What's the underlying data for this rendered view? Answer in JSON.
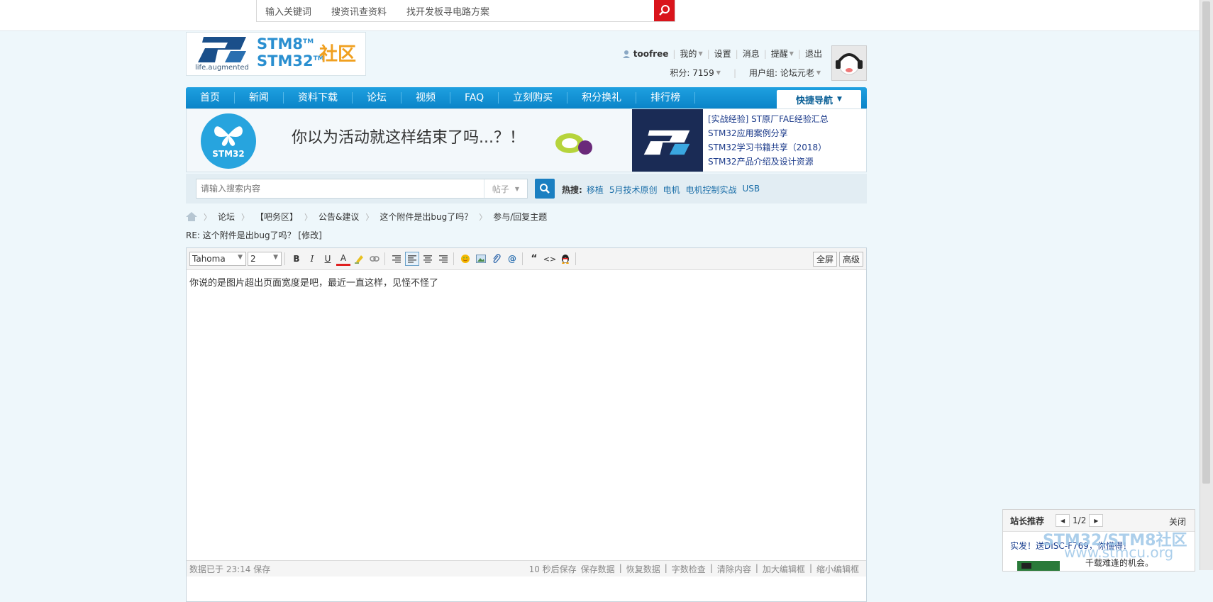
{
  "top_search": {
    "items": [
      "输入关键词",
      "搜资讯查资料",
      "找开发板寻电路方案"
    ]
  },
  "logo": {
    "tagline": "life.augmented",
    "line1": "STM8",
    "line2": "STM32",
    "tm": "TM",
    "community": "社区"
  },
  "user": {
    "name": "toofree",
    "links": [
      "我的",
      "设置",
      "消息",
      "提醒",
      "退出"
    ],
    "points": "积分: 7159",
    "group": "用户组: 论坛元老"
  },
  "nav": {
    "items": [
      "首页",
      "新闻",
      "资料下载",
      "论坛",
      "视频",
      "FAQ",
      "立刻购买",
      "积分换礼",
      "排行榜"
    ],
    "quick": "快捷导航"
  },
  "banner": {
    "ad_text": "你以为活动就这样结束了吗...？！",
    "ad_logo": "STM32",
    "links": [
      "[实战经验] ST原厂FAE经验汇总",
      "STM32应用案例分享",
      "STM32学习书籍共享（2018）",
      "STM32产品介绍及设计资源"
    ]
  },
  "search": {
    "placeholder": "请输入搜索内容",
    "type": "帖子",
    "hot_label": "热搜:",
    "hot": [
      "移植",
      "5月技术原创",
      "电机",
      "电机控制实战",
      "USB"
    ]
  },
  "breadcrumb": [
    "论坛",
    "【吧务区】",
    "公告&建议",
    "这个附件是出bug了吗？",
    "参与/回复主题"
  ],
  "subject": "RE: 这个附件是出bug了吗？ [修改]",
  "editor": {
    "font": "Tahoma",
    "size": "2",
    "buttons": {
      "bold": "B",
      "italic": "I",
      "underline": "U",
      "color": "A"
    },
    "fullscreen": "全屏",
    "advanced": "高级",
    "content": "你说的是图片超出页面宽度是吧，最近一直这样，见怪不怪了",
    "status_left": "数据已于 23:14 保存",
    "status_right": [
      "10 秒后保存",
      "保存数据",
      "恢复数据",
      "字数检查",
      "清除内容",
      "加大编辑框",
      "缩小编辑框"
    ]
  },
  "promo": {
    "header": "站长推荐",
    "page": "1/2",
    "close": "关闭",
    "title": "实发！送DISC-F769，你懂得！",
    "desc": "千载难逢的机会。"
  },
  "watermark": {
    "line1": "STM32/STM8社区",
    "line2": "www.stmcu.org"
  },
  "colors": {
    "nav_blue": "#0a84c8",
    "brand_red": "#d9141b",
    "link_blue": "#1a6ea8"
  }
}
